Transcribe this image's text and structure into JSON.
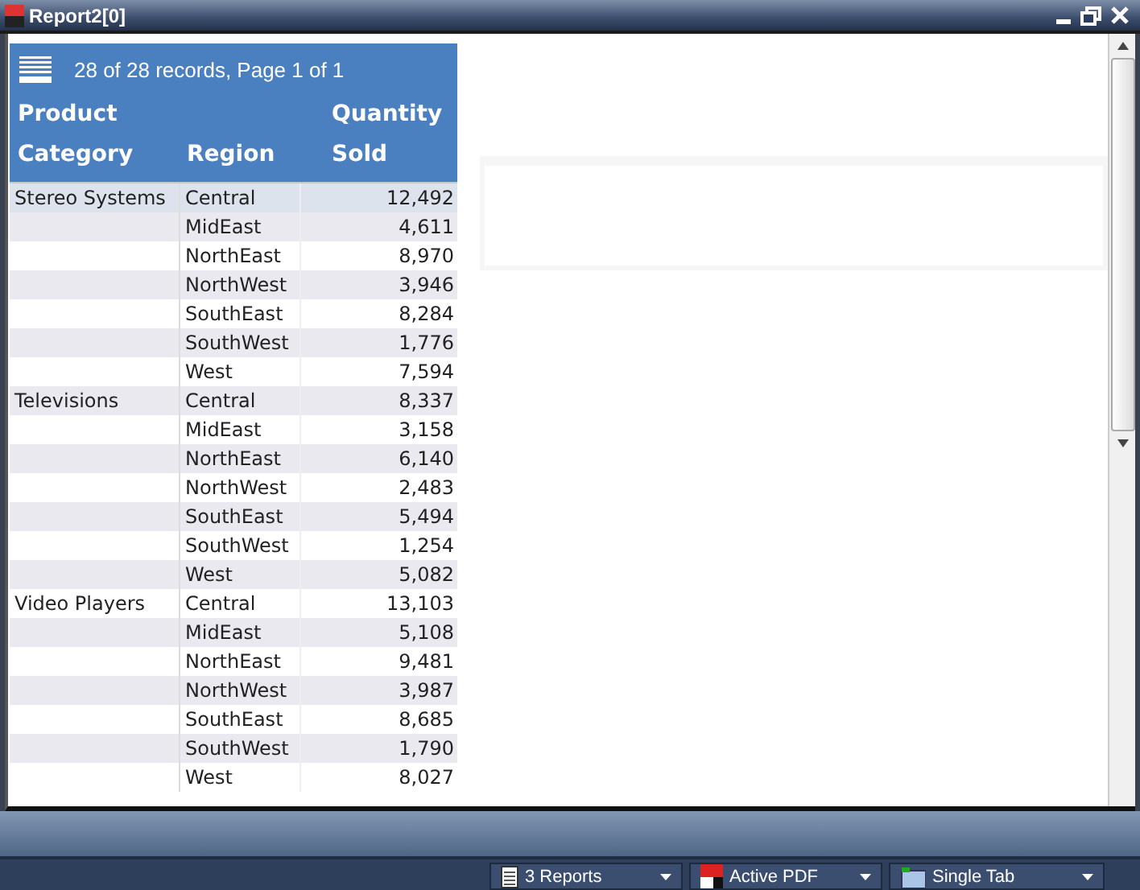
{
  "window": {
    "title": "Report2[0]"
  },
  "report": {
    "summary": "28 of 28 records, Page 1 of 1",
    "columns": [
      {
        "line1": "Product",
        "line2": "Category"
      },
      {
        "line2": "Region"
      },
      {
        "line1": "Quantity",
        "line2": "Sold"
      }
    ],
    "rows": [
      {
        "category": "Stereo Systems",
        "region": "Central",
        "quantity": "12,492",
        "selected": true
      },
      {
        "region": "MidEast",
        "quantity": "4,611",
        "selected": false
      },
      {
        "region": "NorthEast",
        "quantity": "8,970",
        "selected": false
      },
      {
        "region": "NorthWest",
        "quantity": "3,946",
        "selected": false
      },
      {
        "region": "SouthEast",
        "quantity": "8,284",
        "selected": false
      },
      {
        "region": "SouthWest",
        "quantity": "1,776",
        "selected": false
      },
      {
        "region": "West",
        "quantity": "7,594",
        "selected": false
      },
      {
        "category": "Televisions",
        "region": "Central",
        "quantity": "8,337",
        "selected": false
      },
      {
        "region": "MidEast",
        "quantity": "3,158",
        "selected": false
      },
      {
        "region": "NorthEast",
        "quantity": "6,140",
        "selected": false
      },
      {
        "region": "NorthWest",
        "quantity": "2,483",
        "selected": false
      },
      {
        "region": "SouthEast",
        "quantity": "5,494",
        "selected": false
      },
      {
        "region": "SouthWest",
        "quantity": "1,254",
        "selected": false
      },
      {
        "region": "West",
        "quantity": "5,082",
        "selected": false
      },
      {
        "category": "Video Players",
        "region": "Central",
        "quantity": "13,103",
        "selected": false
      },
      {
        "region": "MidEast",
        "quantity": "5,108",
        "selected": false
      },
      {
        "region": "NorthEast",
        "quantity": "9,481",
        "selected": false
      },
      {
        "region": "NorthWest",
        "quantity": "3,987",
        "selected": false
      },
      {
        "region": "SouthEast",
        "quantity": "8,685",
        "selected": false
      },
      {
        "region": "SouthWest",
        "quantity": "1,790",
        "selected": false
      },
      {
        "region": "West",
        "quantity": "8,027",
        "selected": false
      }
    ]
  },
  "status_bar": [
    {
      "kind": "reports",
      "label": "3 Reports"
    },
    {
      "kind": "pdf",
      "label": "Active PDF"
    },
    {
      "kind": "tab",
      "label": "Single Tab"
    }
  ]
}
